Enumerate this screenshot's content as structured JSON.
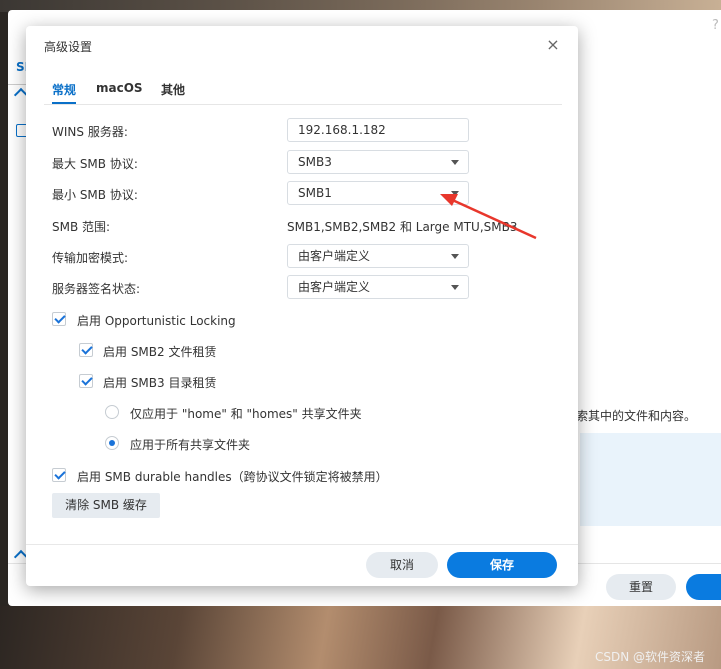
{
  "background": {
    "tab_partial": "SI",
    "help_icon": "?",
    "text_fragment": "索其中的文件和内容。",
    "reset_button": "重置"
  },
  "dialog": {
    "title": "高级设置",
    "close_icon": "×",
    "tabs": [
      {
        "label": "常规",
        "active": true
      },
      {
        "label": "macOS",
        "active": false
      },
      {
        "label": "其他",
        "active": false
      }
    ],
    "wins_label": "WINS 服务器:",
    "wins_value": "192.168.1.182",
    "max_smb_label": "最大 SMB 协议:",
    "max_smb_value": "SMB3",
    "min_smb_label": "最小 SMB 协议:",
    "min_smb_value": "SMB1",
    "range_label": "SMB 范围:",
    "range_value": "SMB1,SMB2,SMB2 和 Large MTU,SMB3",
    "encrypt_label": "传输加密模式:",
    "encrypt_value": "由客户端定义",
    "signing_label": "服务器签名状态:",
    "signing_value": "由客户端定义",
    "opportunistic_locking": {
      "label": "启用 Opportunistic Locking",
      "checked": true
    },
    "smb2_lease": {
      "label": "启用 SMB2 文件租赁",
      "checked": true
    },
    "smb3_lease": {
      "label": "启用 SMB3 目录租赁",
      "checked": true
    },
    "radio_home": {
      "label": "仅应用于 \"home\" 和 \"homes\" 共享文件夹",
      "selected": false
    },
    "radio_all": {
      "label": "应用于所有共享文件夹",
      "selected": true
    },
    "durable_handles": {
      "label": "启用 SMB durable handles（跨协议文件锁定将被禁用）",
      "checked": true
    },
    "clear_cache_button": "清除 SMB 缓存",
    "cancel_button": "取消",
    "save_button": "保存"
  },
  "annotation": {
    "color": "#e8372c"
  },
  "watermark": "CSDN @软件资深者",
  "colors": {
    "accent": "#0a7be0",
    "tab_active": "#0a70c8"
  }
}
